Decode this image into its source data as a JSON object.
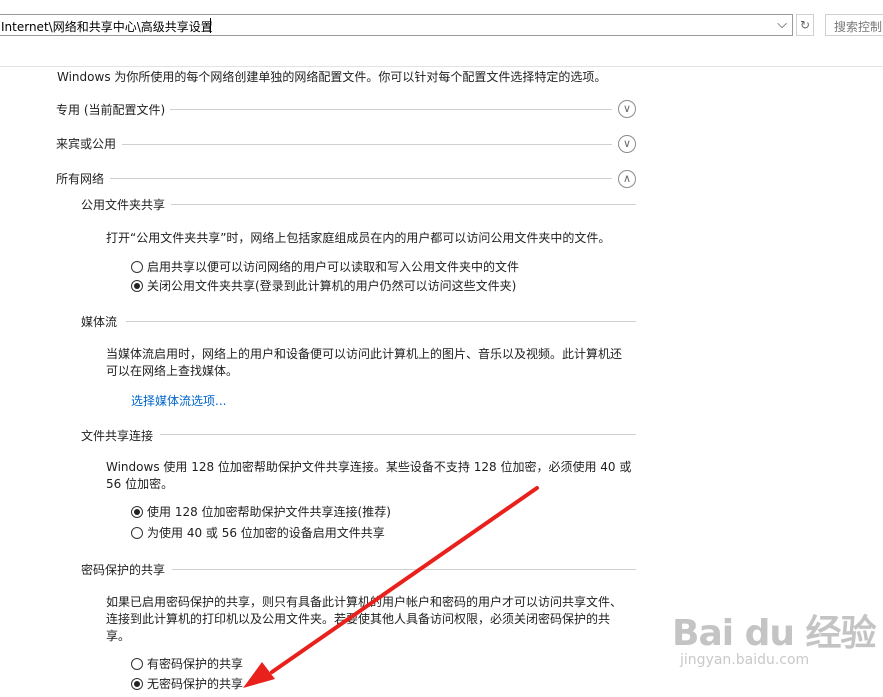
{
  "address_bar": {
    "path": "Internet\\网络和共享中心\\高级共享设置",
    "dropdown_icon": "chevron-down-icon",
    "refresh_icon": "refresh-icon",
    "search_placeholder": "搜索控制"
  },
  "intro": "Windows 为你所使用的每个网络创建单独的网络配置文件。你可以针对每个配置文件选择特定的选项。",
  "profiles": [
    {
      "label": "专用 (当前配置文件)",
      "state": "collapsed"
    },
    {
      "label": "来宾或公用",
      "state": "collapsed"
    },
    {
      "label": "所有网络",
      "state": "expanded"
    }
  ],
  "sections": {
    "public_folder": {
      "title": "公用文件夹共享",
      "description": "打开“公用文件夹共享”时，网络上包括家庭组成员在内的用户都可以访问公用文件夹中的文件。",
      "options": [
        {
          "label": "启用共享以便可以访问网络的用户可以读取和写入公用文件夹中的文件",
          "selected": false
        },
        {
          "label": "关闭公用文件夹共享(登录到此计算机的用户仍然可以访问这些文件夹)",
          "selected": true
        }
      ]
    },
    "media": {
      "title": "媒体流",
      "description_line1": "当媒体流启用时，网络上的用户和设备便可以访问此计算机上的图片、音乐以及视频。此计算机还",
      "description_line2": "可以在网络上查找媒体。",
      "link": "选择媒体流选项..."
    },
    "file_sharing": {
      "title": "文件共享连接",
      "description_line1": "Windows 使用 128 位加密帮助保护文件共享连接。某些设备不支持 128 位加密，必须使用 40 或",
      "description_line2": "56 位加密。",
      "options": [
        {
          "label": "使用 128 位加密帮助保护文件共享连接(推荐)",
          "selected": true
        },
        {
          "label": "为使用 40 或 56 位加密的设备启用文件共享",
          "selected": false
        }
      ]
    },
    "password": {
      "title": "密码保护的共享",
      "description_line1": "如果已启用密码保护的共享，则只有具备此计算机的用户帐户和密码的用户才可以访问共享文件、",
      "description_line2": "连接到此计算机的打印机以及公用文件夹。若要使其他人具备访问权限，必须关闭密码保护的共",
      "description_line3": "享。",
      "options": [
        {
          "label": "有密码保护的共享",
          "selected": false
        },
        {
          "label": "无密码保护的共享",
          "selected": true
        }
      ]
    }
  },
  "annotation": {
    "type": "red-arrow",
    "color": "#e8211c"
  },
  "watermark": {
    "main": "Bai du 经验",
    "sub": "jingyan.baidu.com"
  }
}
